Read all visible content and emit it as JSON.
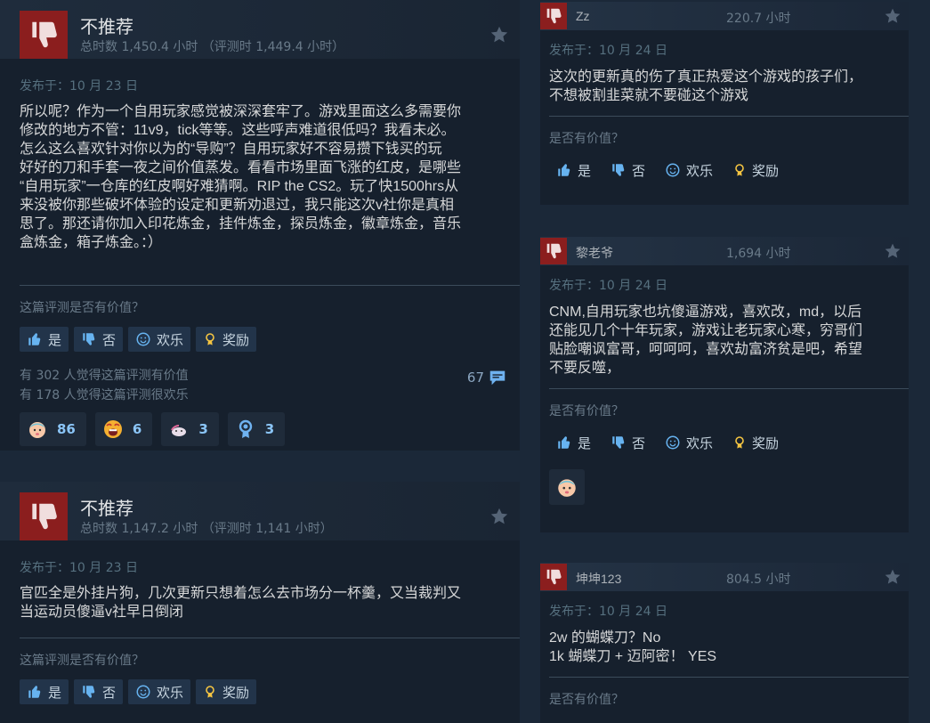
{
  "left_reviews": [
    {
      "recommendation": "不推荐",
      "hours": "总时数 1,450.4 小时 （评测时 1,449.4 小时）",
      "posted": "发布于：10 月 23 日",
      "text": "所以呢？作为一个自用玩家感觉被深深套牢了。游戏里面这么多需要你\n修改的地方不管：11v9，tick等等。这些呼声难道很低吗？我看未必。\n怎么这么喜欢针对你以为的“导购”？自用玩家好不容易攒下钱买的玩\n好好的刀和手套一夜之间价值蒸发。看看市场里面飞涨的红皮，是哪些\n“自用玩家”一仓库的红皮啊好难猜啊。RIP the CS2。玩了快1500hrs从\n来没被你那些破坏体验的设定和更新劝退过，我只能这次v社你是真相\n思了。那还请你加入印花炼金，挂件炼金，探员炼金，徽章炼金，音乐\n盒炼金，箱子炼金。：）",
      "helpful_question": "这篇评测是否有价值？",
      "buttons": {
        "yes": "是",
        "no": "否",
        "funny": "欢乐",
        "award": "奖励"
      },
      "helpful_count": "有 302 人觉得这篇评测有价值",
      "funny_count": "有 178 人觉得这篇评测很欢乐",
      "comments": "67",
      "awards": [
        {
          "icon": "baby-face-award-icon",
          "count": "86"
        },
        {
          "icon": "screaming-face-award-icon",
          "count": "6"
        },
        {
          "icon": "cute-blob-award-icon",
          "count": "3"
        },
        {
          "icon": "ribbon-medal-award-icon",
          "count": "3"
        }
      ]
    },
    {
      "recommendation": "不推荐",
      "hours": "总时数 1,147.2 小时 （评测时 1,141 小时）",
      "posted": "发布于：10 月 23 日",
      "text": "官匹全是外挂片狗，几次更新只想着怎么去市场分一杯羹，又当裁判又\n当运动员傻逼v社早日倒闭",
      "helpful_question": "这篇评测是否有价值？",
      "buttons": {
        "yes": "是",
        "no": "否",
        "funny": "欢乐",
        "award": "奖励"
      }
    }
  ],
  "right_reviews": [
    {
      "user": "Zz",
      "hours": "220.7 小时",
      "posted": "发布于：10 月 24 日",
      "text": "这次的更新真的伤了真正热爱这个游戏的孩子们，\n不想被割韭菜就不要碰这个游戏",
      "helpful_question": "是否有价值？",
      "buttons": {
        "yes": "是",
        "no": "否",
        "funny": "欢乐",
        "award": "奖励"
      }
    },
    {
      "user": "黎老爷",
      "hours": "1,694 小时",
      "posted": "发布于：10 月 24 日",
      "text": "CNM,自用玩家也坑傻逼游戏，喜欢改，md，以后\n还能见几个十年玩家，游戏让老玩家心寒，穷哥们\n贴脸嘲讽富哥，呵呵呵，喜欢劫富济贫是吧，希望\n不要反噬，",
      "helpful_question": "是否有价值？",
      "buttons": {
        "yes": "是",
        "no": "否",
        "funny": "欢乐",
        "award": "奖励"
      },
      "award_icon": "baby-face-award-icon"
    },
    {
      "user": "坤坤123",
      "hours": "804.5 小时",
      "posted": "发布于：10 月 24 日",
      "text": "2w 的蝴蝶刀？No\n1k 蝴蝶刀 + 迈阿密！ YES",
      "helpful_question": "是否有价值？"
    }
  ],
  "colors": {
    "thumb_down": "#8b1e1e",
    "award_count": "#8bc5f7",
    "background": "#1b2838"
  }
}
